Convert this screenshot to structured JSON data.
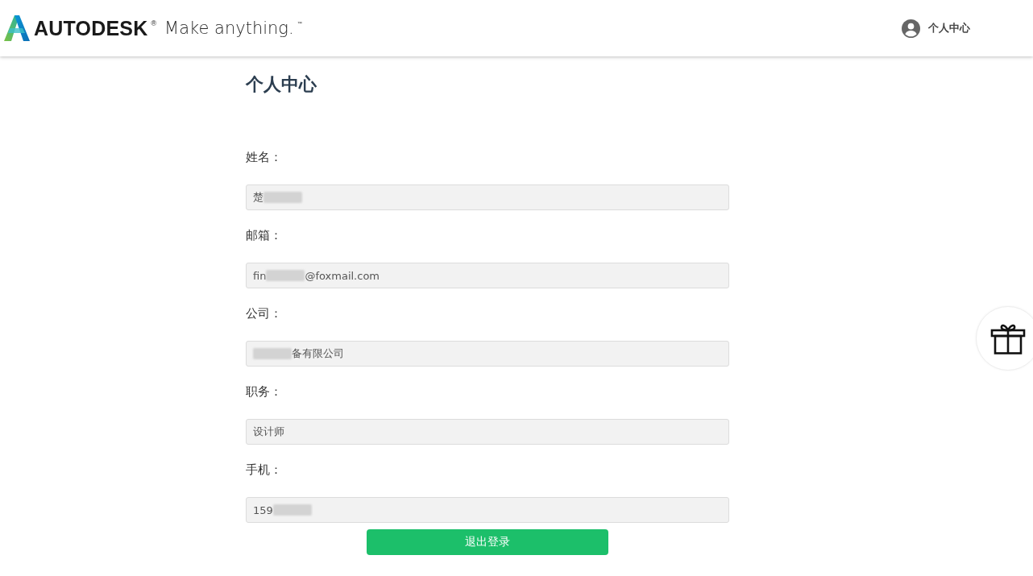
{
  "header": {
    "brand": "AUTODESK",
    "registered_mark": "®",
    "tagline": "Make anything.",
    "trademark": "™",
    "user_menu": {
      "label": "个人中心"
    }
  },
  "page_title": "个人中心",
  "fields": [
    {
      "label": "姓名：",
      "value": [
        {
          "kind": "text",
          "text": "楚"
        },
        {
          "kind": "redacted"
        }
      ]
    },
    {
      "label": "邮箱：",
      "value": [
        {
          "kind": "text",
          "text": "fin"
        },
        {
          "kind": "redacted"
        },
        {
          "kind": "text",
          "text": "@foxmail.com"
        }
      ]
    },
    {
      "label": "公司：",
      "value": [
        {
          "kind": "redacted"
        },
        {
          "kind": "text",
          "text": "备有限公司"
        }
      ]
    },
    {
      "label": "职务：",
      "value": [
        {
          "kind": "text",
          "text": "设计师"
        }
      ]
    },
    {
      "label": "手机：",
      "value": [
        {
          "kind": "text",
          "text": "159"
        },
        {
          "kind": "redacted"
        }
      ]
    }
  ],
  "logout_button": {
    "label": "退出登录"
  }
}
